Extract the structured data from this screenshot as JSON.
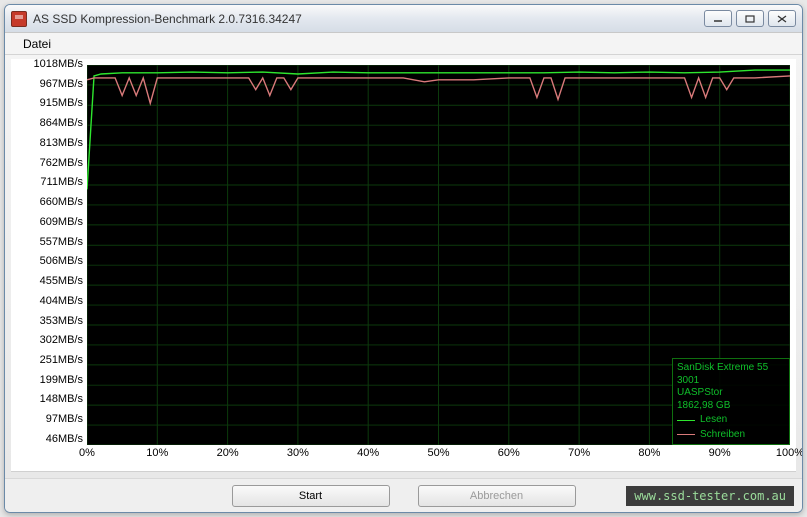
{
  "window": {
    "title": "AS SSD Kompression-Benchmark 2.0.7316.34247"
  },
  "menu": {
    "file": "Datei"
  },
  "buttons": {
    "start": "Start",
    "cancel": "Abbrechen"
  },
  "legend": {
    "device": "SanDisk Extreme 55",
    "model": "3001",
    "controller": "UASPStor",
    "capacity": "1862,98 GB",
    "read": "Lesen",
    "write": "Schreiben",
    "read_color": "#2ee62e",
    "write_color": "#d97a7a"
  },
  "watermark": "www.ssd-tester.com.au",
  "chart_data": {
    "type": "line",
    "xlabel": "",
    "ylabel": "",
    "x_unit": "%",
    "y_unit": "MB/s",
    "xlim": [
      0,
      100
    ],
    "ylim": [
      46,
      1018
    ],
    "x_ticks": [
      0,
      10,
      20,
      30,
      40,
      50,
      60,
      70,
      80,
      90,
      100
    ],
    "y_ticks": [
      1018,
      967,
      915,
      864,
      813,
      762,
      711,
      660,
      609,
      557,
      506,
      455,
      404,
      353,
      302,
      251,
      199,
      148,
      97,
      46
    ],
    "series": [
      {
        "name": "Lesen",
        "color": "#2ee62e",
        "x": [
          0,
          1,
          2,
          5,
          10,
          15,
          20,
          25,
          30,
          35,
          40,
          45,
          50,
          55,
          60,
          65,
          70,
          75,
          80,
          85,
          90,
          95,
          100
        ],
        "values": [
          700,
          990,
          995,
          998,
          998,
          1000,
          998,
          1000,
          995,
          1000,
          998,
          998,
          998,
          998,
          998,
          998,
          1000,
          998,
          1000,
          998,
          1000,
          1005,
          1005
        ]
      },
      {
        "name": "Schreiben",
        "color": "#d97a7a",
        "x": [
          0,
          1,
          2,
          4,
          5,
          6,
          7,
          8,
          9,
          10,
          12,
          15,
          20,
          23,
          24,
          25,
          26,
          27,
          28,
          29,
          30,
          35,
          40,
          45,
          48,
          50,
          55,
          60,
          63,
          64,
          65,
          66,
          67,
          68,
          69,
          70,
          75,
          80,
          85,
          86,
          87,
          88,
          89,
          90,
          91,
          92,
          95,
          100
        ],
        "values": [
          980,
          985,
          985,
          985,
          940,
          985,
          940,
          985,
          920,
          985,
          985,
          985,
          985,
          985,
          955,
          985,
          940,
          985,
          985,
          955,
          985,
          985,
          985,
          985,
          975,
          980,
          980,
          985,
          985,
          935,
          985,
          985,
          930,
          985,
          985,
          985,
          985,
          985,
          985,
          935,
          985,
          935,
          985,
          985,
          955,
          985,
          985,
          990
        ]
      }
    ]
  }
}
